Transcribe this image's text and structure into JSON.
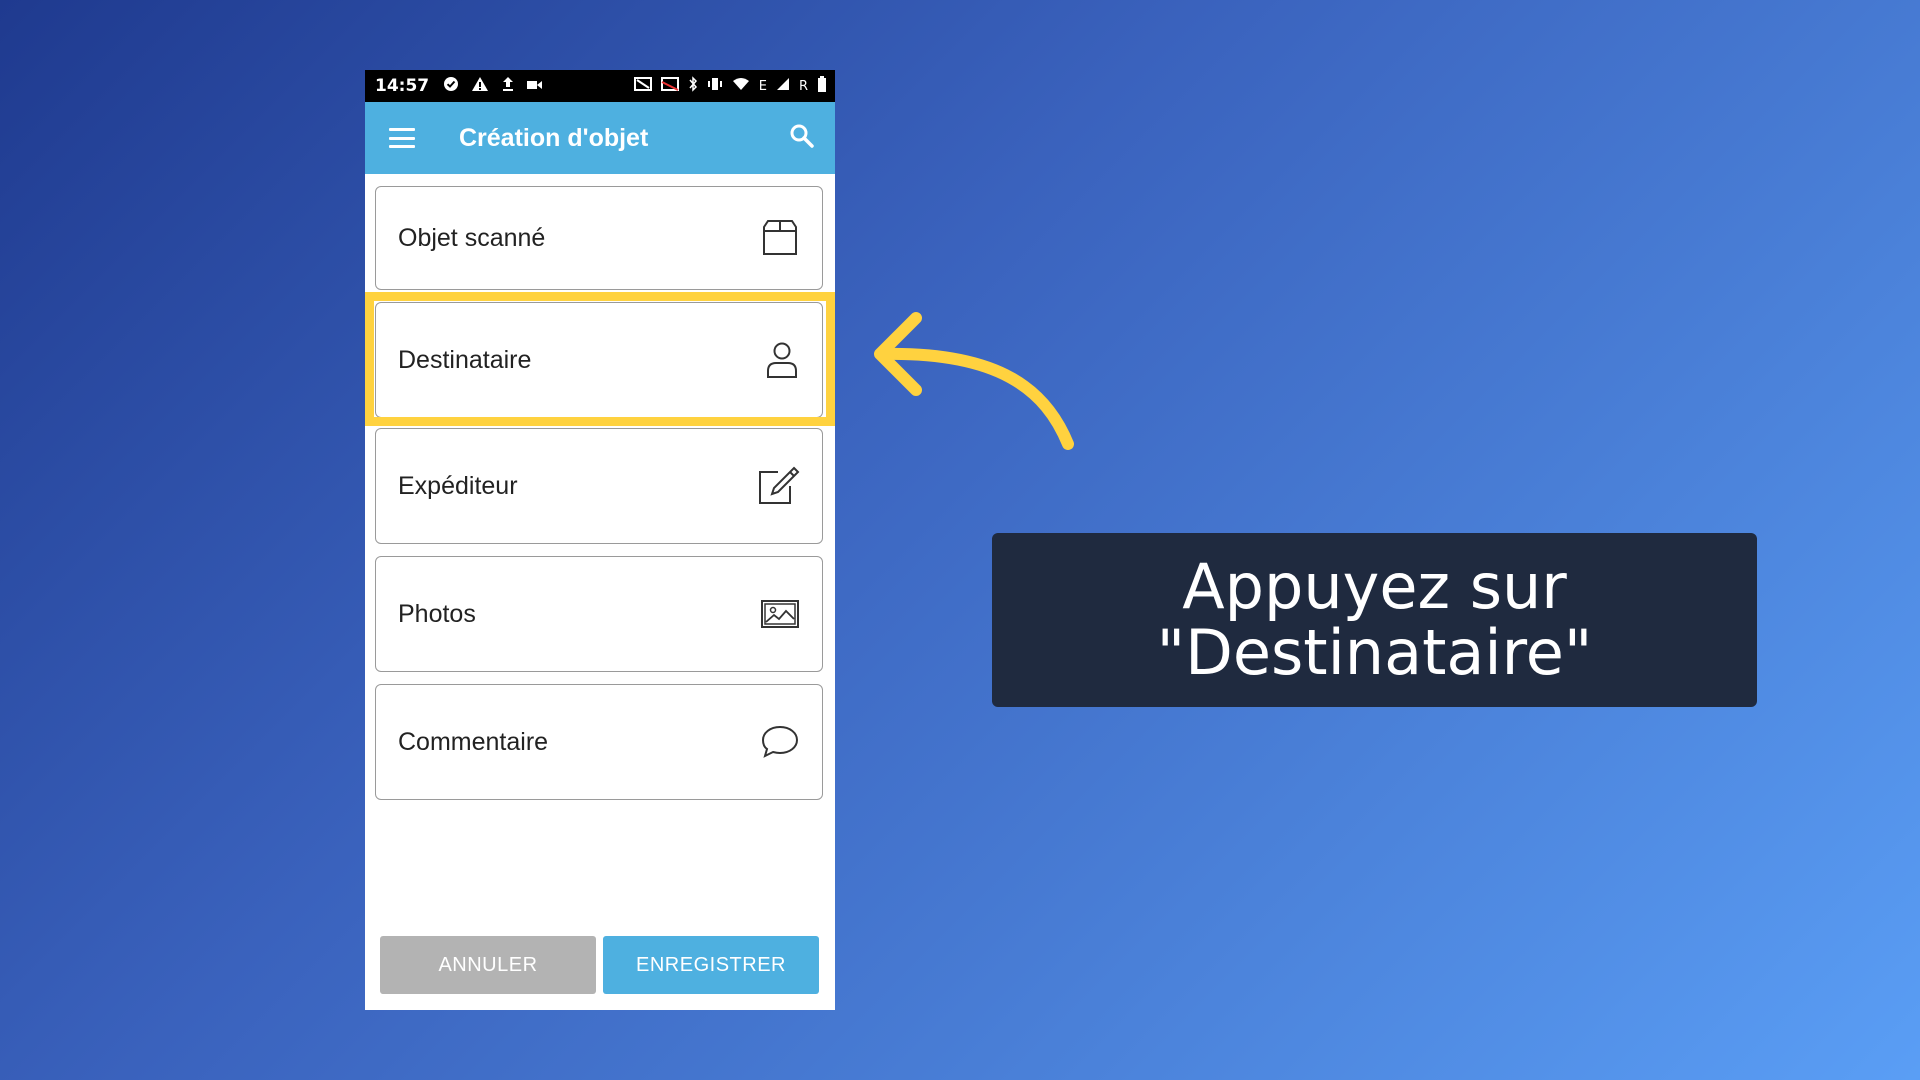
{
  "status_bar": {
    "time": "14:57",
    "network_label": "E",
    "roaming_label": "R",
    "icons": [
      "check-circle-icon",
      "warning-icon",
      "upload-icon",
      "video-icon",
      "nfc-icon",
      "cast-icon",
      "bluetooth-icon",
      "vibrate-icon",
      "wifi-icon",
      "signal-icon",
      "battery-icon"
    ]
  },
  "app_bar": {
    "title": "Création d'objet",
    "icons": [
      "menu-icon",
      "search-icon"
    ]
  },
  "items": [
    {
      "label": "Objet scanné",
      "icon": "box-icon"
    },
    {
      "label": "Destinataire",
      "icon": "person-icon"
    },
    {
      "label": "Expéditeur",
      "icon": "edit-icon"
    },
    {
      "label": "Photos",
      "icon": "image-icon"
    },
    {
      "label": "Commentaire",
      "icon": "comment-icon"
    }
  ],
  "buttons": {
    "cancel": "ANNULER",
    "save": "ENREGISTRER"
  },
  "callout": {
    "line1": "Appuyez sur",
    "line2": "\"Destinataire\""
  },
  "colors": {
    "app_bar": "#4eb0e0",
    "highlight": "#ffd23f",
    "callout_bg": "#1f2a3f",
    "cancel_button": "#b3b3b3",
    "save_button": "#4eb0e0"
  }
}
